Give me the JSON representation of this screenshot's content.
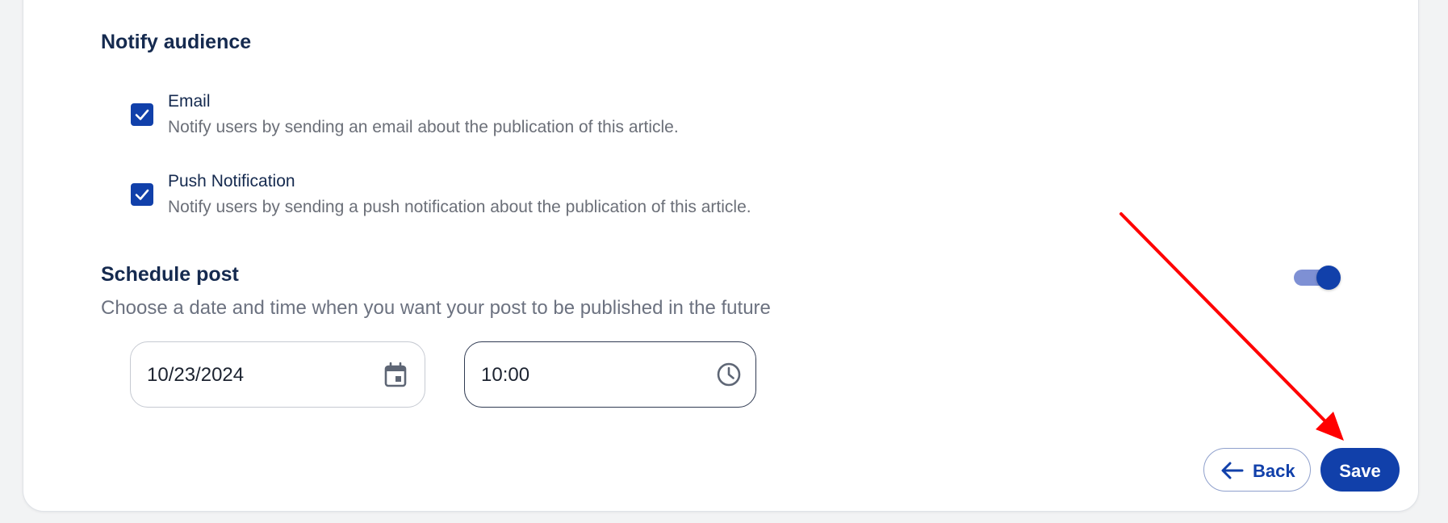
{
  "notify": {
    "title": "Notify audience",
    "options": [
      {
        "label": "Email",
        "description": "Notify users by sending an email about the publication of this article.",
        "checked": true
      },
      {
        "label": "Push Notification",
        "description": "Notify users by sending a push notification about the publication of this article.",
        "checked": true
      }
    ]
  },
  "schedule": {
    "title": "Schedule post",
    "subtitle": "Choose a date and time when you want your post to be published in the future",
    "enabled": true,
    "date_value": "10/23/2024",
    "time_value": "10:00",
    "date_icon": "calendar-icon",
    "time_icon": "clock-icon"
  },
  "actions": {
    "back_label": "Back",
    "save_label": "Save",
    "back_icon": "arrow-left-icon"
  },
  "annotation": {
    "type": "red-arrow",
    "target": "save-button",
    "color": "#ff0000"
  },
  "colors": {
    "primary": "#1140aa",
    "toggle_track": "#7e90d4",
    "heading": "#152a4f",
    "muted": "#6b6f78"
  }
}
